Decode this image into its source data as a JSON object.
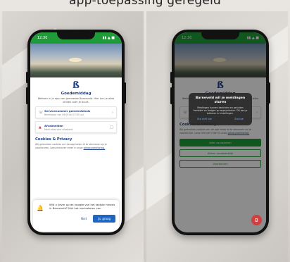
{
  "caption": "app-toepassing geregeld",
  "status": {
    "time": "12:30",
    "right": "▮▮ ▲ ■"
  },
  "home": {
    "logo_glyph": "ß",
    "greeting": "Goedemiddag",
    "intro": "Welkom in je app van gemeente Barneveld. Hier kun je alles vinden over je buurt.",
    "cards": [
      {
        "title": "Servicenummer gemeentebuis",
        "subtitle": "Bereikbaar van 09:00 tot 17:00 uur",
        "icon": "phone-icon"
      },
      {
        "title": "Afvalmelden",
        "subtitle": "Meld afval voor afvalpost",
        "icon": "warning-icon"
      }
    ],
    "section_title": "Cookies & Privacy",
    "section_text": "Wij gebruiken cookies om de app beter af te stemmen op je voorkeuren. Lees hierover meer in onze",
    "section_link": "privacyverklaring."
  },
  "notification": {
    "message": "Wilt u liever op de hoogte van het laatste nieuws in Barneveld? Met het inschakelen van",
    "later": "Niet",
    "accept": "Ja, graag"
  },
  "dialog": {
    "title": "Barneveld wil je meldingen sturen",
    "body": "Meldingen kunnen berichten en geluiden bevatten en badges op appsymbolen. Dit kan je beheren in Instellingen.",
    "deny": "Sta niet toe",
    "allow": "Sta toe"
  },
  "right_buttons": {
    "primary": "Alles accepteren",
    "secondary": "Alleen noodzakelijk",
    "tertiary": "Voorkeuren"
  },
  "fab_glyph": "B"
}
